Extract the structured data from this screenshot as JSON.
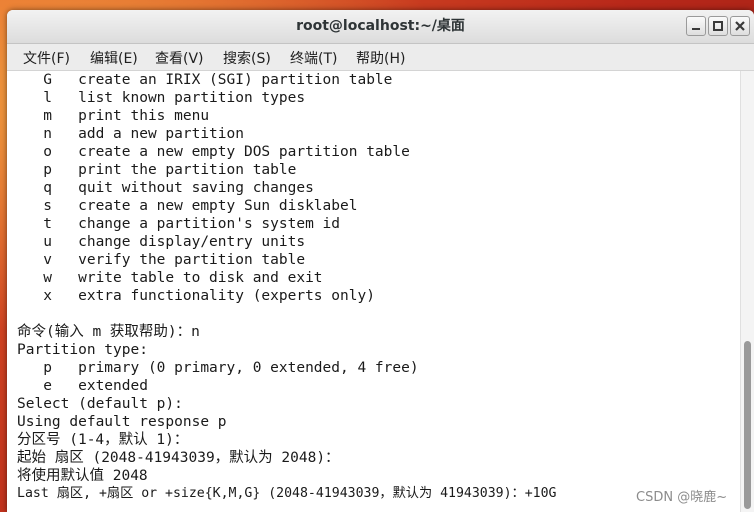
{
  "window": {
    "title": "root@localhost:~/桌面"
  },
  "menubar": {
    "items": [
      "文件(F)",
      "编辑(E)",
      "查看(V)",
      "搜索(S)",
      "终端(T)",
      "帮助(H)"
    ]
  },
  "terminal": {
    "lines": [
      "   G   create an IRIX (SGI) partition table",
      "   l   list known partition types",
      "   m   print this menu",
      "   n   add a new partition",
      "   o   create a new empty DOS partition table",
      "   p   print the partition table",
      "   q   quit without saving changes",
      "   s   create a new empty Sun disklabel",
      "   t   change a partition's system id",
      "   u   change display/entry units",
      "   v   verify the partition table",
      "   w   write table to disk and exit",
      "   x   extra functionality (experts only)",
      "",
      "命令(输入 m 获取帮助)：n",
      "Partition type:",
      "   p   primary (0 primary, 0 extended, 4 free)",
      "   e   extended",
      "Select (default p):",
      "Using default response p",
      "分区号 (1-4，默认 1)：",
      "起始 扇区 (2048-41943039，默认为 2048)：",
      "将使用默认值 2048",
      "Last 扇区, +扇区 or +size{K,M,G} (2048-41943039，默认为 41943039)：+10G"
    ]
  },
  "watermark": "CSDN @晓鹿~",
  "colors": {
    "terminal_bg": "#ffffff",
    "terminal_fg": "#1a1a1a"
  }
}
